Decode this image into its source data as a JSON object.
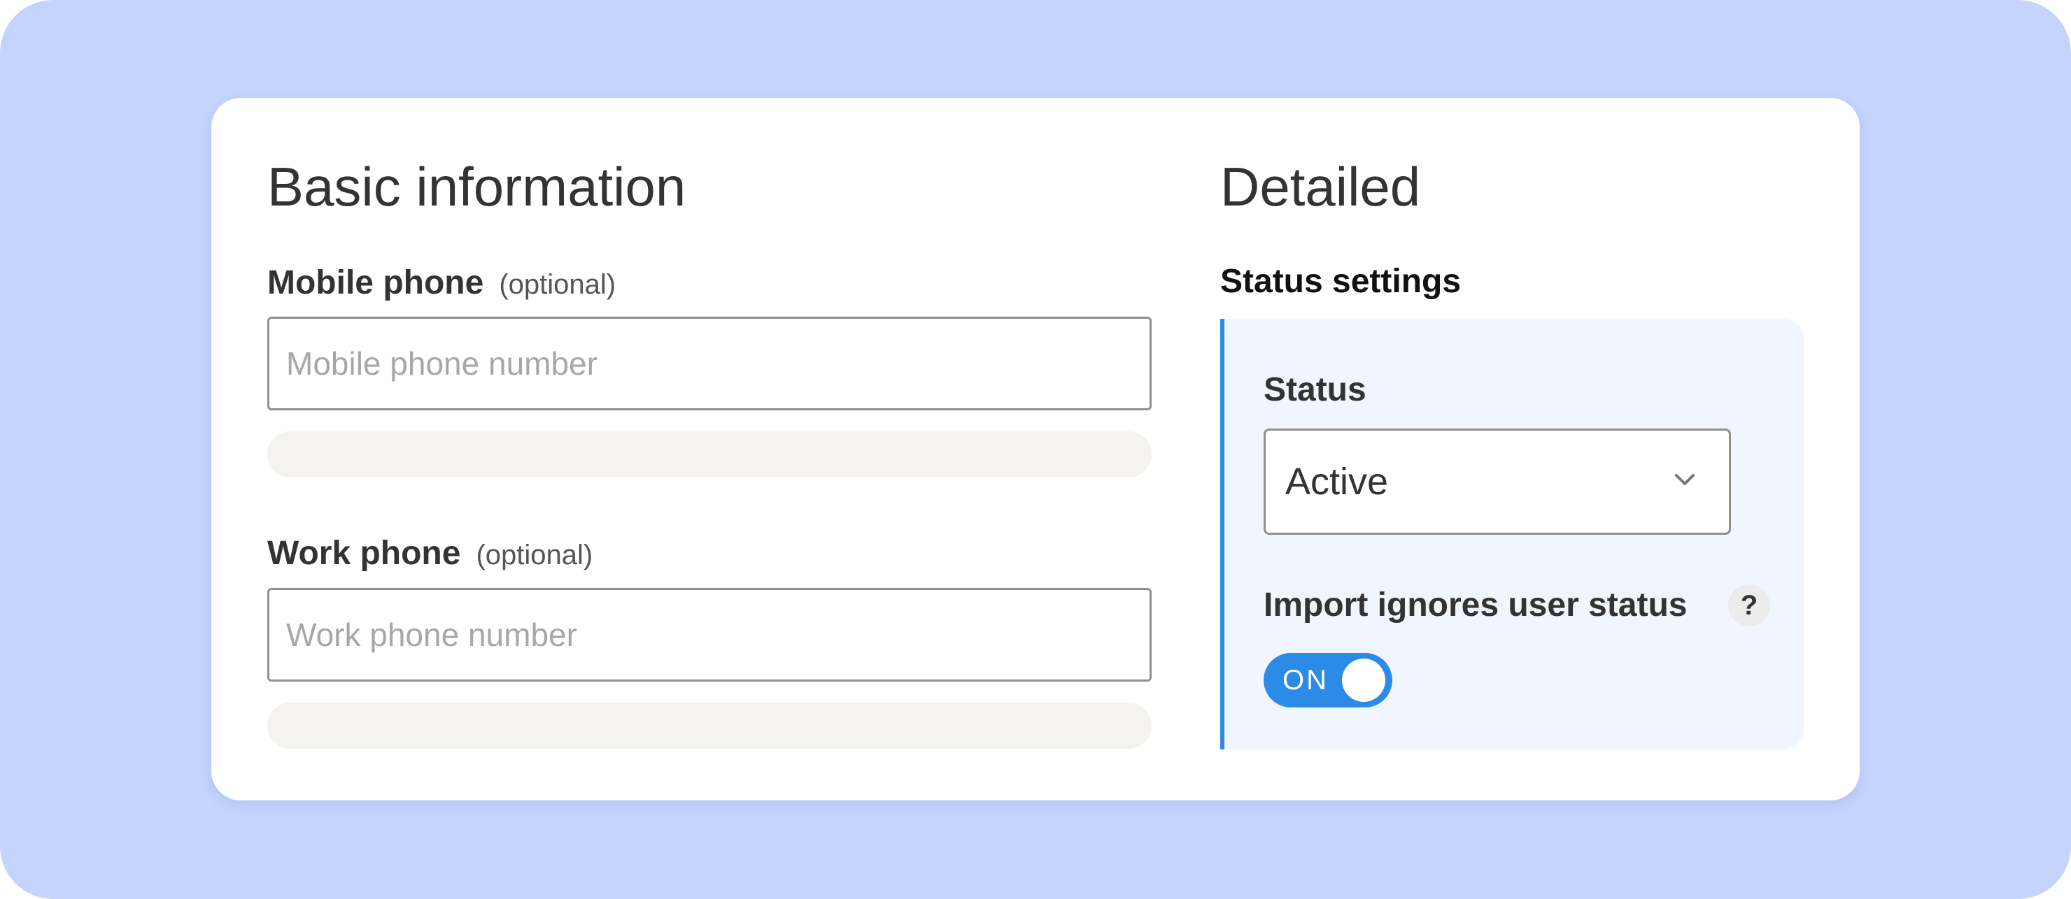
{
  "basic": {
    "title": "Basic information",
    "mobile": {
      "label": "Mobile phone",
      "optional": "(optional)",
      "placeholder": "Mobile phone number",
      "value": ""
    },
    "work": {
      "label": "Work phone",
      "optional": "(optional)",
      "placeholder": "Work phone number",
      "value": ""
    }
  },
  "detailed": {
    "title": "Detailed",
    "status_settings": {
      "heading": "Status settings",
      "status_label": "Status",
      "status_value": "Active",
      "import_label": "Import ignores user status",
      "help_icon": "?",
      "toggle_label": "ON",
      "toggle_on": true
    }
  },
  "colors": {
    "backdrop": "#c4d4fd",
    "accent": "#2b8be6",
    "panel": "#f1f5fe",
    "helper_bar": "#f4f3ef"
  },
  "icons": {
    "select_chevron": "chevron-down-icon",
    "help": "question-mark-icon"
  }
}
